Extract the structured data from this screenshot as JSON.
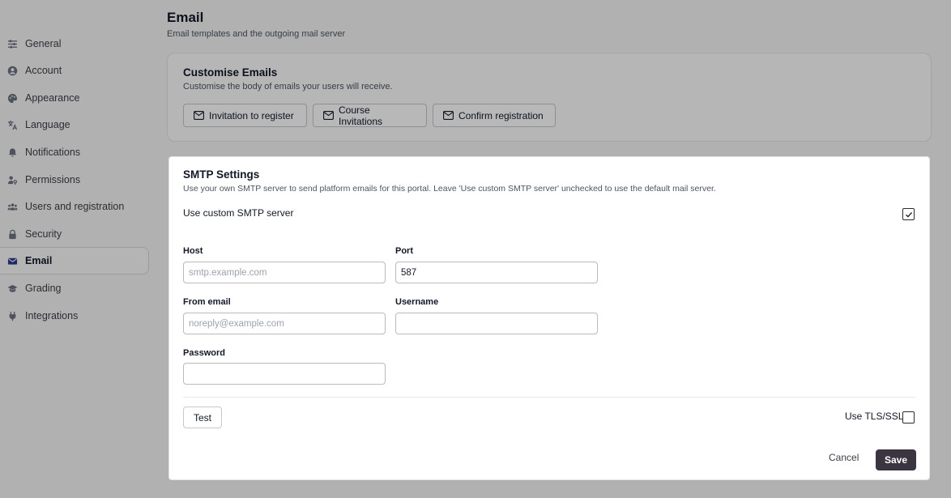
{
  "sidebar": {
    "items": [
      {
        "label": "General",
        "icon": "sliders-icon"
      },
      {
        "label": "Account",
        "icon": "user-circle-icon"
      },
      {
        "label": "Appearance",
        "icon": "palette-icon"
      },
      {
        "label": "Language",
        "icon": "translate-icon"
      },
      {
        "label": "Notifications",
        "icon": "bell-icon"
      },
      {
        "label": "Permissions",
        "icon": "user-key-icon"
      },
      {
        "label": "Users and registration",
        "icon": "users-icon"
      },
      {
        "label": "Security",
        "icon": "lock-icon"
      },
      {
        "label": "Email",
        "icon": "envelope-icon",
        "active": true
      },
      {
        "label": "Grading",
        "icon": "graduation-cap-icon"
      },
      {
        "label": "Integrations",
        "icon": "plug-icon"
      }
    ]
  },
  "page": {
    "title": "Email",
    "subtitle": "Email templates and the outgoing mail server"
  },
  "customise": {
    "title": "Customise Emails",
    "description": "Customise the body of emails your users will receive.",
    "buttons": [
      {
        "label": "Invitation to register"
      },
      {
        "label": "Course Invitations"
      },
      {
        "label": "Confirm registration"
      }
    ]
  },
  "smtp": {
    "title": "SMTP Settings",
    "description": "Use your own SMTP server to send platform emails for this portal. Leave 'Use custom SMTP server' unchecked to use the default mail server.",
    "use_custom_label": "Use custom SMTP server",
    "use_custom_checked": true,
    "host": {
      "label": "Host",
      "value": "",
      "placeholder": "smtp.example.com"
    },
    "port": {
      "label": "Port",
      "value": "587",
      "placeholder": ""
    },
    "from_email": {
      "label": "From email",
      "value": "",
      "placeholder": "noreply@example.com"
    },
    "username": {
      "label": "Username",
      "value": "",
      "placeholder": ""
    },
    "password": {
      "label": "Password",
      "value": "",
      "placeholder": ""
    },
    "test_label": "Test",
    "tls_label": "Use TLS/SSL",
    "tls_checked": false,
    "cancel_label": "Cancel",
    "save_label": "Save"
  },
  "colors": {
    "save_bg": "#3b3542",
    "page_bg": "#f5f5f6"
  }
}
